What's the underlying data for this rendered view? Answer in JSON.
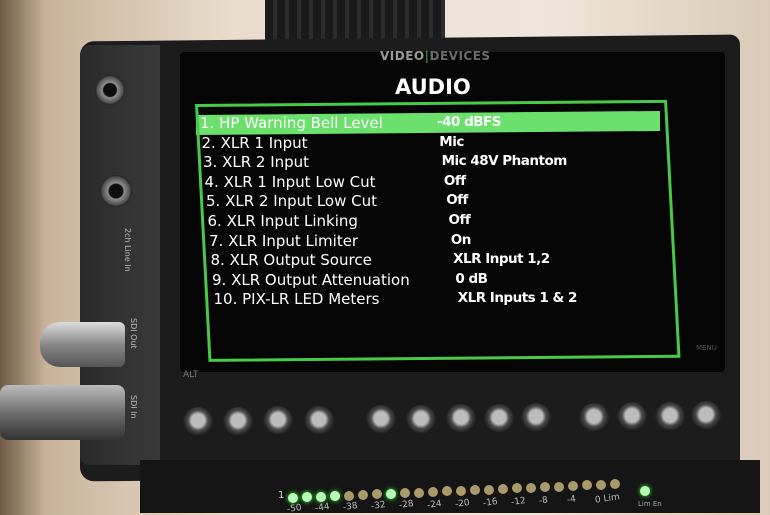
{
  "device": {
    "logo": {
      "left": "VIDEO",
      "right": "DEVICES"
    },
    "side_labels": [
      "2ch Line In",
      "SDI Out",
      "SDI In"
    ],
    "alt_label": "ALT",
    "menu_label": "MENU"
  },
  "screen": {
    "title": "AUDIO",
    "accent_color": "#49c94a",
    "highlight_color": "#6be06c",
    "selected_index": 0,
    "items": [
      {
        "label": "1. HP Warning Bell Level",
        "value": "-40 dBFS"
      },
      {
        "label": "2. XLR 1 Input",
        "value": "Mic"
      },
      {
        "label": "3. XLR 2 Input",
        "value": "Mic 48V Phantom"
      },
      {
        "label": "4. XLR 1 Input Low Cut",
        "value": "Off"
      },
      {
        "label": "5. XLR 2 Input Low Cut",
        "value": "Off"
      },
      {
        "label": "6. XLR Input Linking",
        "value": "Off"
      },
      {
        "label": "7. XLR Input Limiter",
        "value": "On"
      },
      {
        "label": "8. XLR Output Source",
        "value": "XLR Input 1,2"
      },
      {
        "label": "9. XLR Output Attenuation",
        "value": "0 dB"
      },
      {
        "label": "10. PIX-LR LED Meters",
        "value": "XLR Inputs 1 & 2"
      }
    ]
  },
  "meter": {
    "channel": "1",
    "scale": [
      "-50",
      "-44",
      "-38",
      "-32",
      "-28",
      "-24",
      "-20",
      "-16",
      "-12",
      "-8",
      "-4",
      "0 Lim"
    ],
    "lim_en_label": "Lim En",
    "lit_leds": [
      0,
      1,
      2,
      3,
      7
    ]
  }
}
